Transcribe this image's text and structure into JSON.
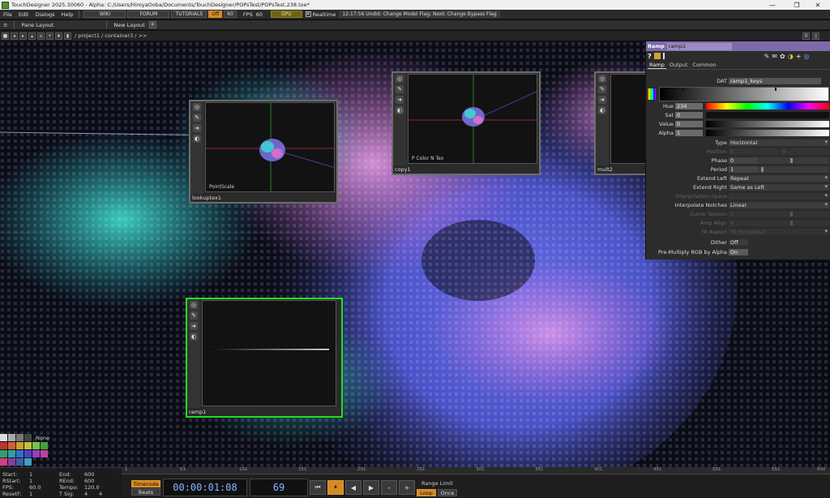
{
  "titlebar": {
    "title": "TouchDesigner 2025.30060 - Alpha: C:/Users/HiroyaOoba/Documents/TouchDesigner/POPsTest/POPsTest.238.toe*",
    "minimize": "—",
    "maximize": "❐",
    "close": "✕"
  },
  "menubar": {
    "items": [
      "File",
      "Edit",
      "Dialogs",
      "Help"
    ],
    "wiki": "WIKI",
    "forum": "FORUM",
    "tutorials": "TUTORIALS",
    "off": "Off",
    "sixty": "60",
    "fps_label": "FPS",
    "fps_value": "60",
    "gpu": "GPU",
    "realtime_check": "✕",
    "realtime": "Realtime",
    "status": "12:17:56 Undid: Change Model Flag; Next: Change Bypass Flag"
  },
  "panebar": {
    "pane_layout": "Pane Layout",
    "new_layout": "New Layout",
    "plus": "+"
  },
  "pathbar": {
    "path": "/ project1 / container3 / >>",
    "right_btn1": "0",
    "right_btn2": "▯"
  },
  "nodes": {
    "lookuptex": {
      "name": "lookuptex1",
      "viewer_label": "PointScale"
    },
    "copy": {
      "name": "copy1",
      "viewer_label": "P Color N Tex"
    },
    "mult": {
      "name": "mult2"
    },
    "ramp": {
      "name": "ramp1"
    }
  },
  "params": {
    "op_type": "Ramp",
    "op_name": "ramp1",
    "help": "?",
    "tabs": [
      "Ramp",
      "Output",
      "Common"
    ],
    "dat_label": "DAT",
    "dat_value": "ramp1_keys",
    "hue_label": "Hue",
    "hue_value": "234",
    "sat_label": "Sat",
    "sat_value": "0",
    "value_label": "Value",
    "value_value": "0",
    "alpha_label": "Alpha",
    "alpha_value": "1",
    "type_label": "Type",
    "type_value": "Horizontal",
    "position_label": "Position",
    "position_x": "0",
    "position_y": "0",
    "phase_label": "Phase",
    "phase_value": "0",
    "period_label": "Period",
    "period_value": "1",
    "extend_left_label": "Extend Left",
    "extend_left_value": "Repeat",
    "extend_right_label": "Extend Right",
    "extend_right_value": "Same as Left",
    "interp_space_label": "Interpolation Space",
    "interp_notches_label": "Interpolate Notches",
    "interp_notches_value": "Linear",
    "curve_tension_label": "Curve Tension",
    "curve_tension_value": "0",
    "amp_align_label": "Amp Align",
    "amp_align_value": "4",
    "fit_aspect_label": "Fit Aspect",
    "fit_aspect_value": "Fit Horizontal",
    "dither_label": "Dither",
    "dither_value": "Off",
    "premult_label": "Pre-Multiply RGB by Alpha",
    "premult_value": "On"
  },
  "timeinfo": {
    "start_label": "Start:",
    "start": "1",
    "end_label": "End:",
    "end": "600",
    "rstart_label": "RStart:",
    "rstart": "1",
    "rend_label": "REnd:",
    "rend": "600",
    "fps_label": "FPS:",
    "fps": "60.0",
    "tempo_label": "Tempo:",
    "tempo": "120.0",
    "resetf_label": "ResetF:",
    "resetf": "1",
    "tsig_label": "T Sig:",
    "tsig_a": "4",
    "tsig_b": "4"
  },
  "ruler": {
    "ticks": [
      "1",
      "51",
      "101",
      "151",
      "201",
      "251",
      "301",
      "351",
      "401",
      "451",
      "501",
      "551",
      "600"
    ]
  },
  "transport": {
    "timecode": "Timecode",
    "beats": "Beats",
    "time": "00:00:01:08",
    "frame": "69",
    "range_limit": "Range Limit",
    "loop": "Loop",
    "once": "Once",
    "btn_first": "⏮",
    "btn_pause": "⏸",
    "btn_back": "◀",
    "btn_fwd": "▶",
    "btn_minus": "–",
    "btn_plus": "+"
  },
  "palette": {
    "none_label": "None"
  },
  "colors": {
    "accent": "#d68a24",
    "ramp_header": "#7d6aa8",
    "selected_node": "#22dd22"
  }
}
